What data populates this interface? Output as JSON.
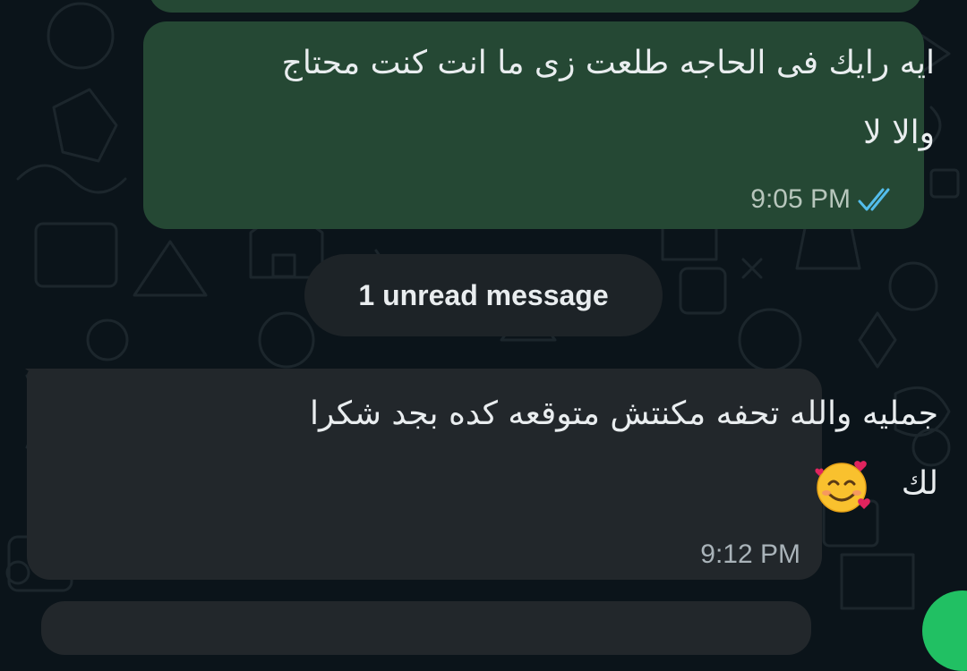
{
  "conversation": {
    "outgoing_message": {
      "line1": "ايه رايك فى الحاجه طلعت زى ما انت كنت محتاج",
      "line2": "والا لا",
      "time": "9:05 PM",
      "status": "read",
      "status_icon": "double-check-icon"
    },
    "unread_divider": {
      "label": "1 unread message"
    },
    "incoming_message": {
      "line1": "جمليه والله تحفه مكنتش متوقعه كده بجد شكرا",
      "line2": "لك",
      "emoji": "smiling-face-with-hearts-icon",
      "time": "9:12 PM"
    }
  },
  "colors": {
    "background": "#0b141a",
    "outgoing_bubble": "#254834",
    "incoming_bubble": "#22272b",
    "read_tick": "#53bdeb",
    "text": "#e9edef",
    "meta_text": "#a9b3b9",
    "fab": "#21c063"
  }
}
